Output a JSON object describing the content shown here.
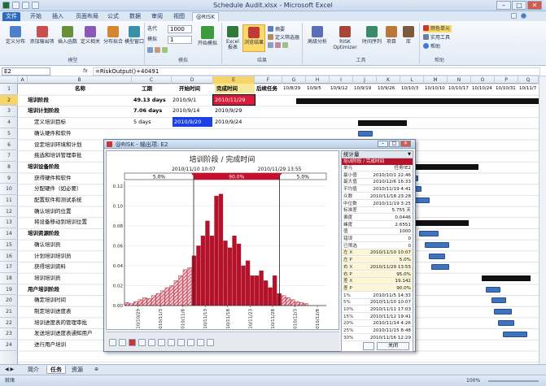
{
  "window": {
    "title": "Schedule Audit.xlsx - Microsoft Excel"
  },
  "tabs": [
    "文件",
    "开始",
    "插入",
    "页面布局",
    "公式",
    "数据",
    "审阅",
    "视图",
    "@RISK"
  ],
  "ribbon": {
    "btn_define_dist": "定义分布",
    "btn_add_output": "添加输出项",
    "btn_insert_func": "插入函数",
    "btn_define_corr": "定义相关",
    "btn_dist_fit": "分布拟合",
    "btn_model_window": "模型窗口",
    "grp_model": "模型",
    "lbl_iterations": "迭代",
    "lbl_simulations": "模拟",
    "iterations_value": "1000",
    "simulations_value": "1",
    "btn_start_sim": "开始模拟",
    "grp_sim": "模拟",
    "btn_excel_report": "Excel 报表",
    "btn_browse_results": "浏览结果",
    "lbl_summary": "摘要",
    "lbl_define_filters": "定义筛选器",
    "grp_results": "结果",
    "btn_advanced": "高级分析",
    "btn_optimizer": "RISK Optimizer",
    "btn_timeseries": "时间序列",
    "btn_project": "项目",
    "btn_library": "库",
    "grp_tools": "工具",
    "lbl_color_cells": "颜色单元",
    "lbl_utilities": "实用工具",
    "lbl_help": "帮助",
    "grp_help": "帮助"
  },
  "formula_bar": {
    "namebox": "E2",
    "fx": "fx",
    "formula": "=RiskOutput()+40491"
  },
  "columns": [
    "A",
    "B",
    "C",
    "D",
    "E",
    "F",
    "G",
    "H",
    "I",
    "J",
    "K",
    "L",
    "M",
    "N",
    "O",
    "P",
    "Q"
  ],
  "header_row": {
    "name": "名称",
    "work": "工期",
    "start": "开始时间",
    "finish": "完成时间",
    "next": "后续任务",
    "dates": [
      "10/8/29",
      "10/9/5",
      "10/9/12",
      "10/9/19",
      "10/9/26",
      "10/10/3",
      "10/10/10",
      "10/10/17",
      "10/10/24",
      "10/10/31",
      "10/11/7"
    ]
  },
  "rows": [
    {
      "n": "2",
      "name": "培训阶段",
      "work": "49.13 days",
      "start": "2010/9/1",
      "finish": "2010/11/29",
      "bold": true
    },
    {
      "n": "3",
      "name": "培训计划阶段",
      "work": "7.06 days",
      "start": "2010/9/14",
      "finish": "2010/9/29",
      "bold": true
    },
    {
      "n": "4",
      "name": "定义培训目标",
      "work": "5 days",
      "start": "2010/9/20",
      "finish": "2010/9/24"
    },
    {
      "n": "5",
      "name": "确认硬件和软件"
    },
    {
      "n": "6",
      "name": "设定培训环境和计划"
    },
    {
      "n": "7",
      "name": "挑选和培训管理审批"
    },
    {
      "n": "8",
      "name": "培训设备阶段",
      "bold": true
    },
    {
      "n": "9",
      "name": "获得硬件和软件"
    },
    {
      "n": "10",
      "name": "分配硬件（如必要）"
    },
    {
      "n": "11",
      "name": "配置软件和测试系统"
    },
    {
      "n": "12",
      "name": "确认培训的位置"
    },
    {
      "n": "13",
      "name": "将设备移动到培训位置"
    },
    {
      "n": "14",
      "name": "培训资源阶段",
      "bold": true
    },
    {
      "n": "15",
      "name": "确认培训员"
    },
    {
      "n": "16",
      "name": "计划培训培训员"
    },
    {
      "n": "17",
      "name": "获得培训资料"
    },
    {
      "n": "18",
      "name": "培训培训员"
    },
    {
      "n": "19",
      "name": "用户培训阶段",
      "bold": true
    },
    {
      "n": "20",
      "name": "确定培训时间"
    },
    {
      "n": "21",
      "name": "制定培训进度表"
    },
    {
      "n": "22",
      "name": "培训进度表的管理审批"
    },
    {
      "n": "23",
      "name": "发送培训进度表通知用户"
    },
    {
      "n": "24",
      "name": "进行用户培训"
    }
  ],
  "sheet_tabs": [
    "简介",
    "任务",
    "资源"
  ],
  "status": {
    "ready": "就绪",
    "zoom": "100%"
  },
  "popup": {
    "title": "@RISK - 输出项: E2",
    "chart_title": "培训阶段 / 完成时间",
    "marker_left": "2010/11/10 10:07",
    "marker_right": "2010/11/29 13:55",
    "pct_left": "5.0%",
    "pct_mid": "90.0%",
    "pct_right": "5.0%",
    "stats_header": "统计量",
    "stats_sub": "培训阶段 / 完成时间",
    "stats_col": "任务!E2",
    "stats": [
      [
        "单元",
        "任务!E2"
      ],
      [
        "最小值",
        "2010/10/1 22:46"
      ],
      [
        "最大值",
        "2010/12/6 16:33"
      ],
      [
        "平均值",
        "2010/11/19 4:41"
      ],
      [
        "众数",
        "2010/11/18 23:28"
      ],
      [
        "中位数",
        "2010/11/19 3:25"
      ],
      [
        "标准差",
        "5.755 天"
      ],
      [
        "偏度",
        "0.0446"
      ],
      [
        "峰度",
        "2.6551"
      ],
      [
        "值",
        "1000"
      ],
      [
        "错误",
        "0"
      ],
      [
        "已筛选",
        "0"
      ],
      [
        "左 X",
        "2010/11/10 10:07"
      ],
      [
        "左 P",
        "5.0%"
      ],
      [
        "右 X",
        "2010/11/29 13:55"
      ],
      [
        "右 P",
        "95.0%"
      ],
      [
        "差 X",
        "19.142"
      ],
      [
        "差 P",
        "90.0%"
      ],
      [
        "1%",
        "2010/11/5 14:33"
      ],
      [
        "5%",
        "2010/11/10 10:07"
      ],
      [
        "10%",
        "2010/11/11 17:03"
      ],
      [
        "15%",
        "2010/11/12 19:41"
      ],
      [
        "20%",
        "2010/11/14 4:26"
      ],
      [
        "25%",
        "2010/11/15 8:48"
      ],
      [
        "30%",
        "2010/11/16 12:29"
      ]
    ],
    "close_label": "关闭"
  },
  "chart_data": {
    "type": "bar",
    "title": "培训阶段 / 完成时间",
    "ylim": [
      0,
      0.12
    ],
    "yticks": [
      "0.12",
      "0.10",
      "0.08",
      "0.06",
      "0.04",
      "0.02",
      "0.00"
    ],
    "x_ticks": [
      "2010/10/29",
      "2010/11/3",
      "2010/11/8",
      "2010/11/13",
      "2010/11/18",
      "2010/11/23",
      "2010/11/28",
      "2010/12/3",
      "2010/12/8"
    ],
    "x_start": "2010/10/26",
    "x_end": "2010/12/10",
    "bin_days": 1,
    "values": [
      0.003,
      0.002,
      0.004,
      0.006,
      0.008,
      0.007,
      0.01,
      0.012,
      0.015,
      0.018,
      0.02,
      0.025,
      0.03,
      0.036,
      0.038,
      0.05,
      0.06,
      0.07,
      0.085,
      0.07,
      0.11,
      0.112,
      0.065,
      0.058,
      0.07,
      0.062,
      0.04,
      0.045,
      0.03,
      0.03,
      0.035,
      0.025,
      0.018,
      0.03,
      0.012,
      0.01,
      0.008,
      0.006,
      0.004,
      0.003,
      0.002
    ],
    "left_marker": "2010/11/10 10:07",
    "right_marker": "2010/11/29 13:55",
    "colors": {
      "bar": "#b3122a",
      "tail_hatch": "#b3122a"
    }
  }
}
